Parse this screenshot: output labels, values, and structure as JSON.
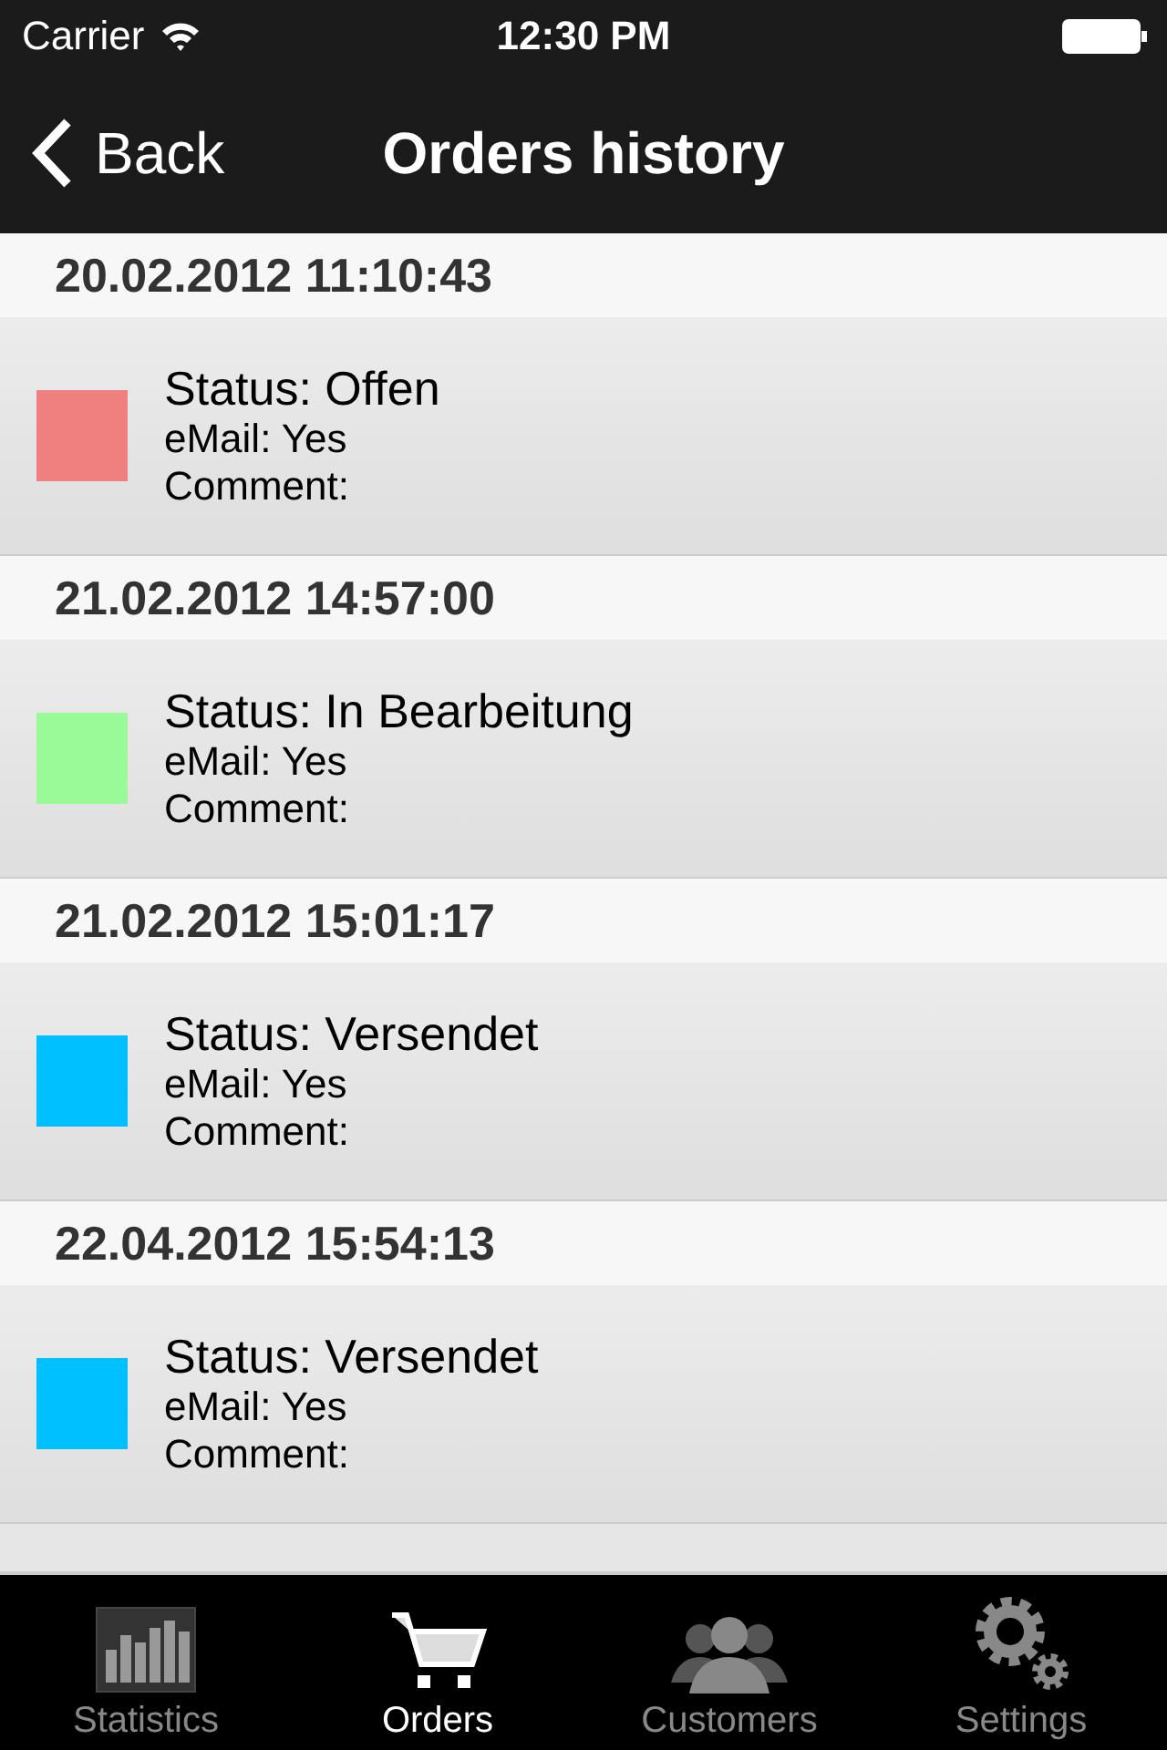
{
  "status_bar": {
    "carrier": "Carrier",
    "time": "12:30 PM"
  },
  "nav_bar": {
    "back": "Back",
    "title": "Orders history"
  },
  "orders": [
    {
      "date": "20.02.2012 11:10:43",
      "status": "Status: Offen",
      "color": "#f08080",
      "email": "eMail: Yes",
      "comment": "Comment:"
    },
    {
      "date": "21.02.2012 14:57:00",
      "status": "Status: In Bearbeitung",
      "color": "#98fb98",
      "email": "eMail: Yes",
      "comment": "Comment:"
    },
    {
      "date": "21.02.2012 15:01:17",
      "status": "Status: Versendet",
      "color": "#00bfff",
      "email": "eMail: Yes",
      "comment": "Comment:"
    },
    {
      "date": "22.04.2012 15:54:13",
      "status": "Status: Versendet",
      "color": "#00bfff",
      "email": "eMail: Yes",
      "comment": "Comment:"
    }
  ],
  "tab_bar": [
    {
      "kind": "chart",
      "label": "Statistics",
      "selected": false
    },
    {
      "kind": "cart",
      "label": "Orders",
      "selected": true
    },
    {
      "kind": "people",
      "label": "Customers",
      "selected": false
    },
    {
      "kind": "gears",
      "label": "Settings",
      "selected": false
    }
  ]
}
